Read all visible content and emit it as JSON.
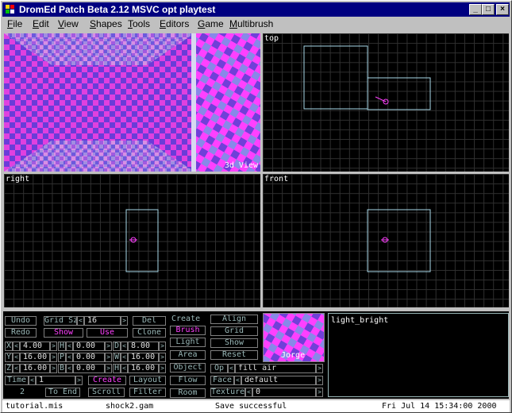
{
  "window": {
    "title": "DromEd Patch Beta 2.12 MSVC opt playtest",
    "minimize_glyph": "_",
    "maximize_glyph": "□",
    "close_glyph": "×"
  },
  "menu": [
    "File",
    "Edit",
    "View",
    "Shapes",
    "Tools",
    "Editors",
    "Game",
    "Multibrush"
  ],
  "views": {
    "view3d_label": "3d View",
    "top_label": "top",
    "right_label": "right",
    "front_label": "front"
  },
  "controls": {
    "undo": "Undo",
    "redo": "Redo",
    "grid_sz_label": "Grid Sz",
    "grid_sz_value": "16",
    "show": "Show",
    "use": "Use",
    "del": "Del",
    "clone": "Clone",
    "coords": [
      {
        "l1": "X",
        "v1": "4.00",
        "l2": "H",
        "v2": "0.00",
        "l3": "D",
        "v3": "8.00"
      },
      {
        "l1": "Y",
        "v1": "16.00",
        "l2": "P",
        "v2": "0.00",
        "l3": "W",
        "v3": "16.00"
      },
      {
        "l1": "Z",
        "v1": "16.00",
        "l2": "B",
        "v2": "0.00",
        "l3": "H",
        "v3": "16.00"
      }
    ],
    "time_label": "Time",
    "time_value": "1",
    "create_label": "Create",
    "layout_label": "Layout",
    "page_number": "2",
    "to_end": "To End",
    "scroll": "Scroll",
    "filter": "Filter",
    "create_header": "Create",
    "brush": "Brush",
    "light": "Light",
    "area": "Area",
    "object": "Object",
    "flow": "Flow",
    "room": "Room",
    "align": "Align",
    "grid": "Grid",
    "show2": "Show",
    "reset": "Reset",
    "op_label": "Op",
    "op_value": "fill air",
    "face_label": "Face",
    "face_value": "default",
    "texture_label": "Texture",
    "texture_value": "0",
    "texture_name": "Jorge",
    "brush_text": "light_bright"
  },
  "status": {
    "file": "tutorial.mis",
    "gamesys": "shock2.gam",
    "message": "Save successful",
    "datetime": "Fri Jul 14 15:34:00 2000"
  },
  "colors": {
    "title_bar": "#000080",
    "brush_outline": "#a8d8e8",
    "light_marker": "#ff40ff",
    "button_text": "#9ab8b8",
    "highlight_text": "#ff40ff"
  }
}
